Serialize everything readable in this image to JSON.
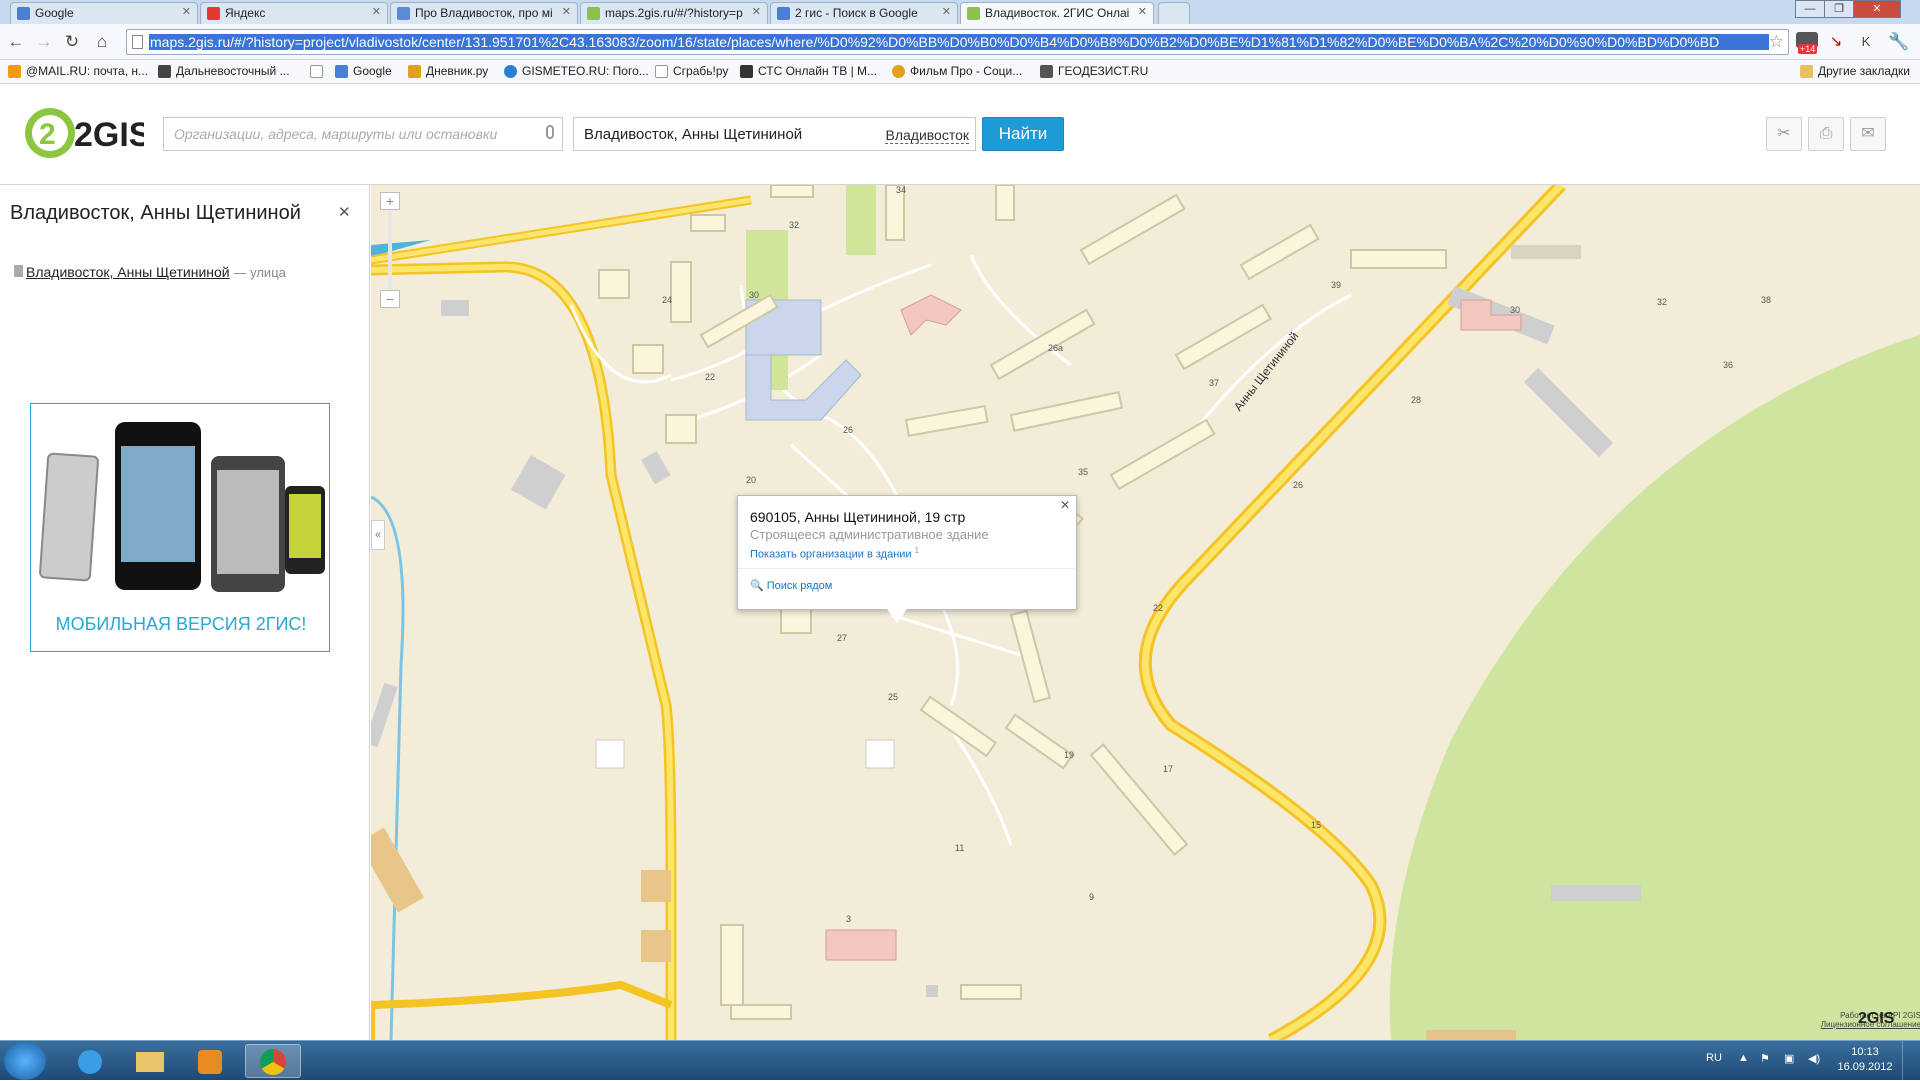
{
  "browser": {
    "tabs": [
      {
        "title": "Google",
        "color": "#4a7fd4"
      },
      {
        "title": "Яндекс",
        "color": "#e23b2e"
      },
      {
        "title": "Про Владивосток, про мі",
        "color": "#5b8bd6"
      },
      {
        "title": "maps.2gis.ru/#/?history=p",
        "color": "#8bc34a"
      },
      {
        "title": "2 гис - Поиск в Google",
        "color": "#4a7fd4"
      },
      {
        "title": "Владивосток. 2ГИС Онлаі",
        "color": "#8bc34a"
      }
    ],
    "url": "maps.2gis.ru/#/?history=project/vladivostok/center/131.951701%2C43.163083/zoom/16/state/places/where/%D0%92%D0%BB%D0%B0%D0%B4%D0%B8%D0%B2%D0%BE%D1%81%D1%82%D0%BE%D0%BA%2C%20%D0%90%D0%BD%D0%BD",
    "badge": "+14",
    "bookmarks": [
      {
        "label": "@MAIL.RU: почта, н...",
        "color": "#f39c12"
      },
      {
        "label": "Дальневосточный ...",
        "color": "#444"
      },
      {
        "label": "",
        "color": "#ddd"
      },
      {
        "label": "Google",
        "color": "#4a7fd4"
      },
      {
        "label": "Дневник.ру",
        "color": "#e0a020"
      },
      {
        "label": "GISMETEO.RU: Пого...",
        "color": "#2a7fd4"
      },
      {
        "label": "Сграбь!ру",
        "color": "#ccc"
      },
      {
        "label": "СТС Онлайн ТВ | М...",
        "color": "#333"
      },
      {
        "label": "Фильм Про - Соци...",
        "color": "#e0a020"
      },
      {
        "label": "ГЕОДЕЗИСТ.RU",
        "color": "#555"
      }
    ],
    "other_bookmarks": "Другие закладки"
  },
  "header": {
    "logo": "2GIS",
    "search_placeholder": "Организации, адреса, маршруты или остановки",
    "where_value": "Владивосток, Анны Щетининой",
    "city": "Владивосток",
    "find_label": "Найти"
  },
  "sidebar": {
    "title": "Владивосток, Анны Щетининой",
    "result_link": "Владивосток, Анны Щетининой",
    "result_type": "— улица",
    "ad_text": "МОБИЛЬНАЯ ВЕРСИЯ 2ГИС!"
  },
  "map": {
    "street_label": "Анны Щетининой",
    "numbers": [
      "34",
      "32",
      "24",
      "30",
      "22",
      "20",
      "27",
      "25",
      "26",
      "26а",
      "37",
      "35",
      "39",
      "30",
      "32",
      "38",
      "36",
      "28",
      "26",
      "22",
      "19",
      "17",
      "15",
      "11",
      "9",
      "3"
    ],
    "popup": {
      "address": "690105, Анны Щетининой, 19 стр",
      "desc": "Строящееся административное здание",
      "orgs_link": "Показать организации в здании",
      "orgs_count": "1",
      "nearby": "Поиск рядом"
    },
    "copyright_1": "Работает на API 2GIS",
    "copyright_2": "Лицензионное соглашение",
    "copyright_logo": "2GIS"
  },
  "taskbar": {
    "lang": "RU",
    "time": "10:13",
    "date": "16.09.2012"
  }
}
